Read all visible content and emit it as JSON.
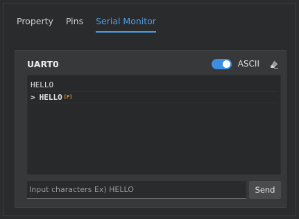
{
  "tabs": [
    {
      "label": "Property",
      "active": false
    },
    {
      "label": "Pins",
      "active": false
    },
    {
      "label": "Serial Monitor",
      "active": true
    }
  ],
  "panel": {
    "title": "UART0",
    "toggle_on": true,
    "mode_label": "ASCII",
    "clear_icon": "eraser-icon"
  },
  "console": {
    "lines": [
      {
        "prompt": "",
        "text": "HELLO",
        "tag": ""
      },
      {
        "prompt": ">",
        "text": "HELLO",
        "tag": "[P]"
      }
    ]
  },
  "input": {
    "value": "",
    "placeholder": "Input characters Ex) HELLO",
    "send_label": "Send"
  },
  "colors": {
    "accent": "#4f9de6",
    "tag": "#e49a2b"
  }
}
